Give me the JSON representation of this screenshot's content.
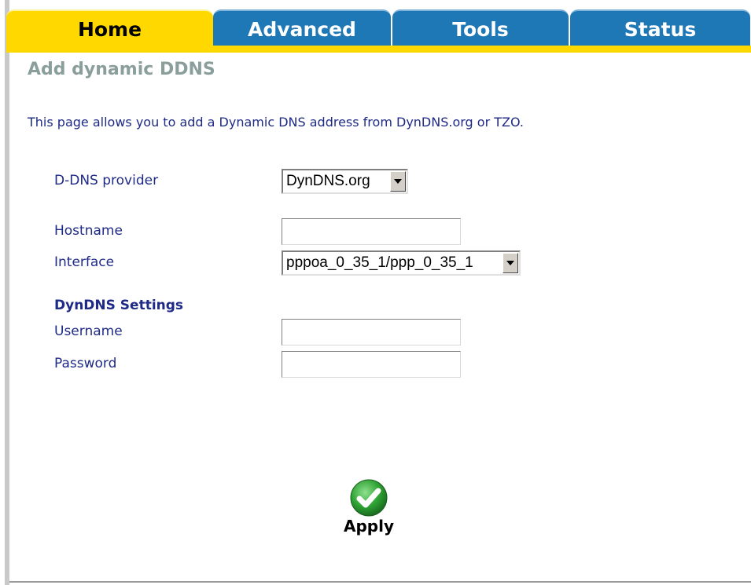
{
  "tabs": [
    {
      "label": "Home"
    },
    {
      "label": "Advanced"
    },
    {
      "label": "Tools"
    },
    {
      "label": "Status"
    }
  ],
  "page_title": "Add dynamic DDNS",
  "intro": "This page allows you to add a Dynamic DNS address from DynDNS.org or TZO.",
  "form": {
    "provider_label": "D-DNS provider",
    "provider_value": "DynDNS.org",
    "hostname_label": "Hostname",
    "hostname_value": "",
    "interface_label": "Interface",
    "interface_value": "pppoa_0_35_1/ppp_0_35_1",
    "settings_heading": "DynDNS Settings",
    "username_label": "Username",
    "username_value": "",
    "password_label": "Password",
    "password_value": ""
  },
  "apply": {
    "label": "Apply",
    "icon": "checkmark-icon"
  },
  "colors": {
    "tab_active": "#ffd800",
    "tab_inactive": "#1f78b6",
    "label_text": "#1e2a86",
    "title_text": "#8a9e9b",
    "apply_green": "#2fa334"
  }
}
